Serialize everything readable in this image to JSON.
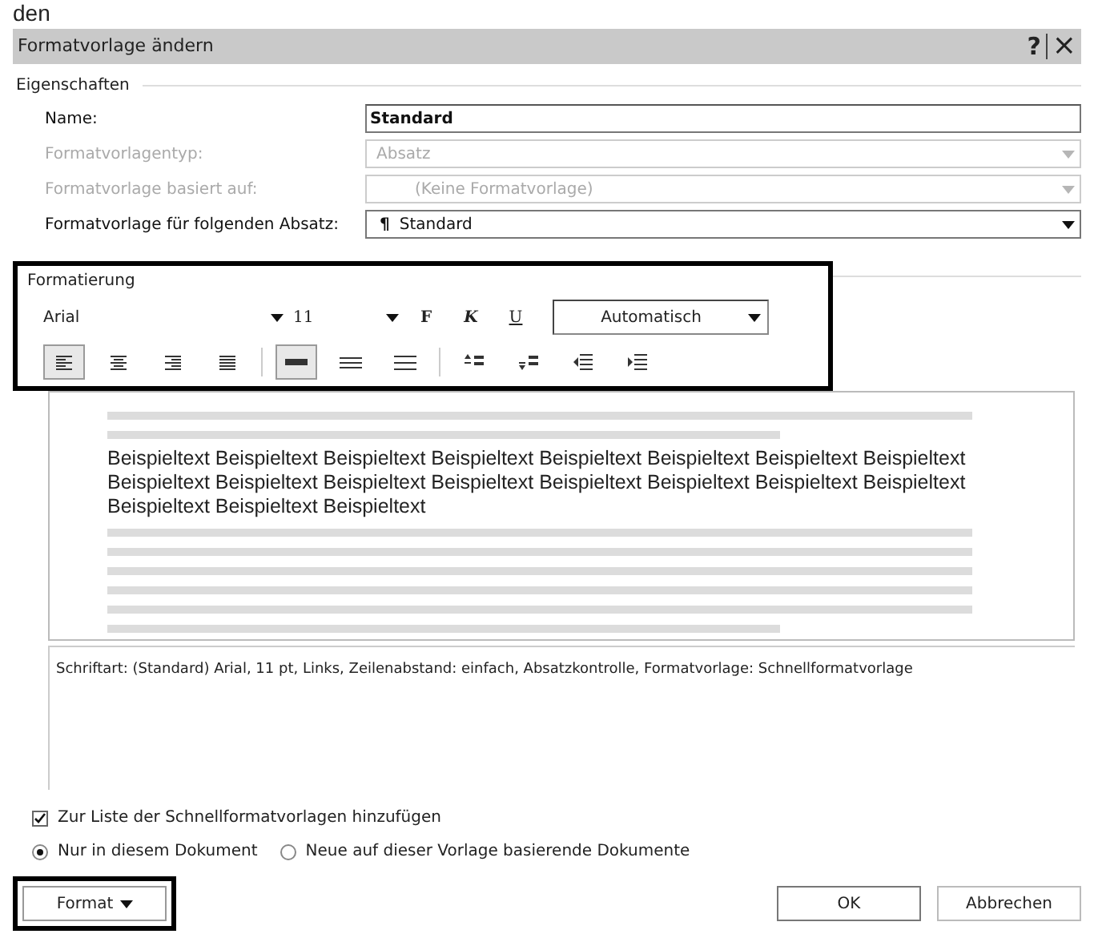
{
  "page_fragment": "den",
  "window": {
    "title": "Formatvorlage ändern",
    "help": "?",
    "close": "×"
  },
  "properties": {
    "heading": "Eigenschaften",
    "rows": [
      {
        "label": "Name:",
        "value": "Standard",
        "kind": "text",
        "disabled": false
      },
      {
        "label": "Formatvorlagentyp:",
        "value": "Absatz",
        "kind": "select",
        "disabled": true
      },
      {
        "label": "Formatvorlage basiert auf:",
        "value": "(Keine Formatvorlage)",
        "kind": "select",
        "disabled": true
      },
      {
        "label": "Formatvorlage für folgenden Absatz:",
        "value": "Standard",
        "pilcrow": "¶",
        "kind": "select",
        "disabled": false
      }
    ]
  },
  "formatting": {
    "heading": "Formatierung",
    "font": "Arial",
    "size": "11",
    "bold": "F",
    "italic": "K",
    "underline": "U",
    "font_color_label": "Automatisch",
    "highlighted": true,
    "alignment": [
      {
        "kind": "left",
        "selected": true
      },
      {
        "kind": "center",
        "selected": false
      },
      {
        "kind": "right",
        "selected": false
      },
      {
        "kind": "justify",
        "selected": false
      }
    ],
    "spacing": [
      {
        "kind": "single",
        "selected": true
      },
      {
        "kind": "onehalf",
        "selected": false
      },
      {
        "kind": "double",
        "selected": false
      }
    ],
    "paragraph": [
      {
        "kind": "space-before"
      },
      {
        "kind": "space-after"
      },
      {
        "kind": "outdent"
      },
      {
        "kind": "indent"
      }
    ]
  },
  "preview": {
    "sample_lines": [
      "Beispieltext Beispieltext Beispieltext Beispieltext Beispieltext Beispieltext Beispieltext Beispieltext",
      "Beispieltext Beispieltext Beispieltext Beispieltext Beispieltext Beispieltext Beispieltext Beispieltext",
      "Beispieltext Beispieltext Beispieltext"
    ]
  },
  "description": "Schriftart: (Standard) Arial, 11 pt, Links, Zeilenabstand:  einfach, Absatzkontrolle, Formatvorlage: Schnellformatvorlage",
  "add_to_quick_list": {
    "label": "Zur Liste der Schnellformatvorlagen hinzufügen",
    "checked": true
  },
  "scope": [
    {
      "label": "Nur in diesem Dokument",
      "selected": true
    },
    {
      "label": "Neue auf dieser Vorlage basierende Dokumente",
      "selected": false
    }
  ],
  "buttons": {
    "format": {
      "label": "Format",
      "highlighted": true
    },
    "ok": "OK",
    "cancel": "Abbrechen"
  }
}
